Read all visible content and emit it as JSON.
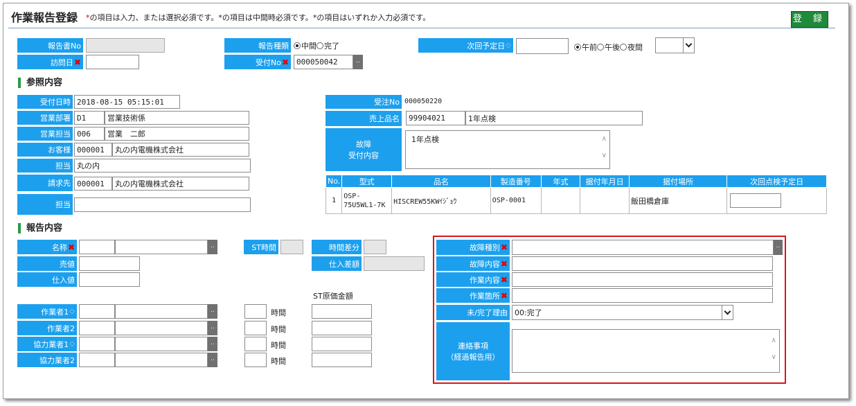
{
  "header": {
    "title": "作業報告登録",
    "note_mark1": "*",
    "note_text1": "の項目は入力、または選択必須です。",
    "note_mark2": "*",
    "note_text2": "の項目は中間時必須です。",
    "note_mark3": "*",
    "note_text3": "の項目はいずれか入力必須です。",
    "register_label": "登 録"
  },
  "top": {
    "report_no_label": "報告書No",
    "report_no_value": "",
    "visit_date_label": "訪問日",
    "visit_date_value": "",
    "report_type_label": "報告種類",
    "report_type_opt1": "中間",
    "report_type_opt2": "完了",
    "receipt_no_label": "受付No",
    "receipt_no_value": "000050042",
    "dots": "..",
    "next_date_label": "次回予定日",
    "next_date_value": "",
    "ampm_opt1": "午前",
    "ampm_opt2": "午後",
    "ampm_opt3": "夜間",
    "ampm_select_value": ""
  },
  "reference": {
    "section_title": "参照内容",
    "receipt_datetime_label": "受付日時",
    "receipt_datetime_value": "2018-08-15 05:15:01",
    "dept_label": "営業部署",
    "dept_code": "D1",
    "dept_name": "営業技術係",
    "sales_rep_label": "営業担当",
    "sales_rep_code": "006",
    "sales_rep_name": "営業　二郎",
    "customer_label": "お客様",
    "customer_code": "000001",
    "customer_name": "丸の内電機株式会社",
    "contact_label": "担当",
    "contact_value": "丸の内",
    "billing_label": "請求先",
    "billing_code": "000001",
    "billing_name": "丸の内電機株式会社",
    "billing_contact_label": "担当",
    "billing_contact_value": "",
    "order_no_label": "受注No",
    "order_no_value": "000050220",
    "product_label": "売上品名",
    "product_code": "99904021",
    "product_name": "1年点検",
    "fault_label_1": "故障",
    "fault_label_2": "受付内容",
    "fault_value": "1年点検"
  },
  "equipment_table": {
    "headers": [
      "No.",
      "型式",
      "品名",
      "製造番号",
      "年式",
      "据付年月日",
      "据付場所",
      "次回点検予定日"
    ],
    "rows": [
      {
        "no": "1",
        "model": "OSP-75U5WL1-7K",
        "name": "HISCREW55KWｲｼﾞｮｳ",
        "serial": "OSP-0001",
        "year": "",
        "install_date": "",
        "location": "飯田橋倉庫",
        "next_inspection": ""
      }
    ]
  },
  "report": {
    "section_title": "報告内容",
    "name_label": "名称",
    "price_label": "売値",
    "purchase_label": "仕入値",
    "st_time_label": "ST時間",
    "time_diff_label": "時間差分",
    "purchase_diff_label": "仕入差額",
    "st_cost_label": "ST原価金額",
    "worker1_label": "作業者1",
    "worker2_label": "作業者2",
    "partner1_label": "協力業者1",
    "partner2_label": "協力業者2",
    "hours_unit": "時間",
    "fault_type_label": "故障種別",
    "fault_detail_label": "故障内容",
    "work_detail_label": "作業内容",
    "work_place_label": "作業箇所",
    "incomplete_reason_label": "未/完了理由",
    "incomplete_reason_value": "00:完了",
    "contact_notes_label_1": "連絡事項",
    "contact_notes_label_2": "（経過報告用）",
    "contact_notes_value": ""
  },
  "colors": {
    "label_bg": "#1ca0ee",
    "register_btn": "#1f8a3a",
    "required_mark": "#d40000",
    "highlight_box": "#d9141b",
    "section_bar": "#2a9a48"
  }
}
